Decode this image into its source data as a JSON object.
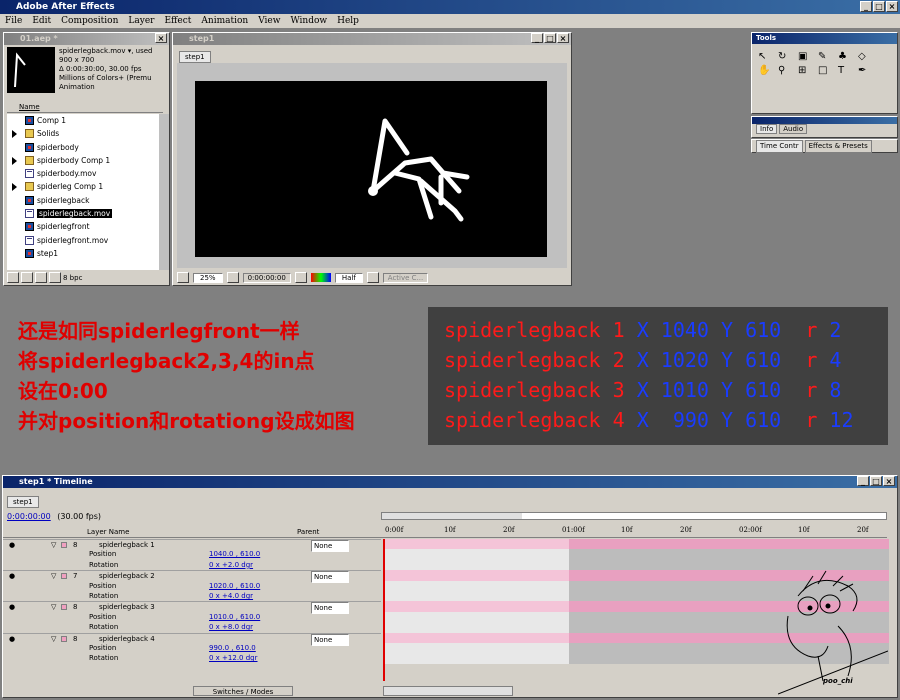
{
  "app": {
    "title": "Adobe After Effects"
  },
  "menu": [
    "File",
    "Edit",
    "Composition",
    "Layer",
    "Effect",
    "Animation",
    "View",
    "Window",
    "Help"
  ],
  "project": {
    "title": "01.aep *",
    "selected_name": "spiderlegback.mov",
    "used_label": "▾, used",
    "info_line1": "900 x 700",
    "info_line2": "Δ 0:00:30:00, 30.00 fps",
    "info_line3": "Millions of Colors+ (Premu",
    "info_line4": "Animation",
    "column_name": "Name",
    "items": [
      {
        "type": "comp",
        "name": "Comp 1"
      },
      {
        "type": "folder",
        "name": "Solids"
      },
      {
        "type": "comp",
        "name": "spiderbody"
      },
      {
        "type": "folder",
        "name": "spiderbody Comp 1"
      },
      {
        "type": "mov",
        "name": "spiderbody.mov"
      },
      {
        "type": "folder",
        "name": "spiderleg Comp 1"
      },
      {
        "type": "comp",
        "name": "spiderlegback"
      },
      {
        "type": "mov",
        "name": "spiderlegback.mov",
        "selected": true
      },
      {
        "type": "comp",
        "name": "spiderlegfront"
      },
      {
        "type": "mov",
        "name": "spiderlegfront.mov"
      },
      {
        "type": "comp",
        "name": "step1"
      }
    ],
    "footer_bpc": "8 bpc"
  },
  "comp_window": {
    "title": "step1",
    "tab": "step1",
    "zoom": "25%",
    "timecode": "0:00:00:00",
    "resolution": "Half",
    "camera": "Active C..."
  },
  "tools": {
    "title": "Tools"
  },
  "info_panel": {
    "tabs": [
      "Info",
      "Audio"
    ]
  },
  "time_panel": {
    "tabs": [
      "Time Contr",
      "Effects & Presets"
    ]
  },
  "notes": {
    "lines": [
      "还是如同spiderlegfront一样",
      "将spiderlegback2,3,4的in点",
      "设在0:00",
      "并对position和rotationg设成如图"
    ]
  },
  "info_box": {
    "rows": [
      {
        "name": "spiderlegback",
        "num": "1",
        "x_label": "X",
        "x": "1040",
        "y_label": "Y",
        "y": "610",
        "r_label": "r",
        "r": "2"
      },
      {
        "name": "spiderlegback",
        "num": "2",
        "x_label": "X",
        "x": "1020",
        "y_label": "Y",
        "y": "610",
        "r_label": "r",
        "r": "4"
      },
      {
        "name": "spiderlegback",
        "num": "3",
        "x_label": "X",
        "x": "1010",
        "y_label": "Y",
        "y": "610",
        "r_label": "r",
        "r": "8"
      },
      {
        "name": "spiderlegback",
        "num": "4",
        "x_label": "X",
        "x": " 990",
        "y_label": "Y",
        "y": "610",
        "r_label": "r",
        "r": "12"
      }
    ]
  },
  "timeline": {
    "title": "step1 * Timeline",
    "tab": "step1",
    "timecode": "0:00:00:00",
    "fps": "(30.00 fps)",
    "col_layer_name": "Layer Name",
    "col_parent": "Parent",
    "footer_switches": "Switches / Modes",
    "ruler": [
      "0:00f",
      "10f",
      "20f",
      "01:00f",
      "10f",
      "20f",
      "02:00f",
      "10f",
      "20f"
    ],
    "layers": [
      {
        "num": "8",
        "name": "spiderlegback 1",
        "parent": "None",
        "position": "1040.0 , 610.0",
        "rotation": "0 x +2.0 dgr"
      },
      {
        "num": "7",
        "name": "spiderlegback 2",
        "parent": "None",
        "position": "1020.0 , 610.0",
        "rotation": "0 x +4.0 dgr"
      },
      {
        "num": "8",
        "name": "spiderlegback 3",
        "parent": "None",
        "position": "1010.0 , 610.0",
        "rotation": "0 x +8.0 dgr"
      },
      {
        "num": "8",
        "name": "spiderlegback 4",
        "parent": "None",
        "position": "990.0 , 610.0",
        "rotation": "0 x +12.0 dgr"
      }
    ],
    "prop_position": "Position",
    "prop_rotation": "Rotation"
  },
  "signature": "poo_chi",
  "colors": {
    "title_active": "#0a246a",
    "panel": "#d4d0c8",
    "layer_bar": "#f4c4d8",
    "note_red": "#e00000",
    "info_bg": "#404040",
    "info_red": "#ff1a1a",
    "info_blue": "#1a3cff"
  }
}
